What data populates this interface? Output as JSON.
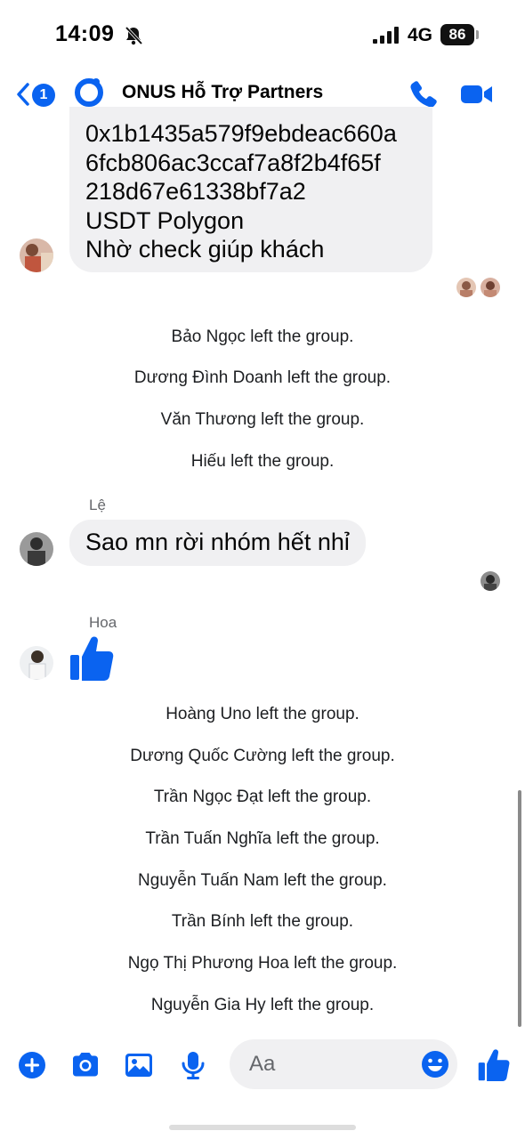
{
  "status_bar": {
    "time": "14:09",
    "network": "4G",
    "battery": "86"
  },
  "header": {
    "unread_count": "1",
    "title": "ONUS Hỗ Trợ Partners",
    "accent_color": "#0a63f0"
  },
  "messages": {
    "top_bubble_lines": [
      "0x1b1435a579f9ebdeac660a",
      "6fcb806ac3ccaf7a8f2b4f65f",
      "218d67e61338bf7a2",
      "USDT Polygon",
      "Nhờ check giúp khách"
    ],
    "system_group1": [
      "Bảo Ngọc left the group.",
      "Dương Đình Doanh left the group.",
      "Văn Thương left the group.",
      "Hiếu left the group."
    ],
    "le_sender": "Lệ",
    "le_text": "Sao mn rời nhóm hết nhỉ",
    "hoa_sender": "Hoa",
    "system_group2": [
      "Hoàng Uno left the group.",
      "Dương Quốc Cường left the group.",
      "Trần Ngọc Đạt left the group.",
      "Trần Tuấn Nghĩa left the group.",
      "Nguyễn Tuấn Nam left the group.",
      "Trần Bính left the group.",
      "Ngọ Thị Phương Hoa left the group.",
      "Nguyễn Gia Hy left the group."
    ]
  },
  "composer": {
    "placeholder": "Aa"
  },
  "icons": [
    "bell-off-icon",
    "signal-icon",
    "back-chevron-icon",
    "onus-logo-icon",
    "phone-icon",
    "video-camera-icon",
    "thumbs-up-icon",
    "plus-icon",
    "camera-icon",
    "image-icon",
    "microphone-icon",
    "emoji-icon"
  ]
}
